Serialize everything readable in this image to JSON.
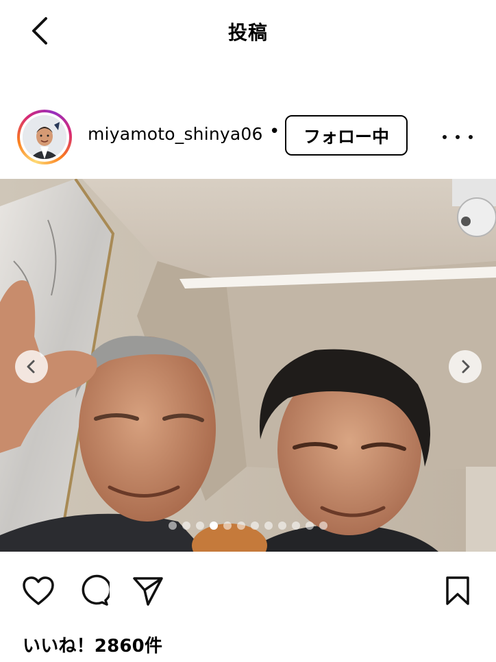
{
  "header": {
    "title": "投稿",
    "back_icon": "chevron-left-icon"
  },
  "post": {
    "username": "miyamoto_shinya06",
    "separator": "•",
    "follow_label": "フォロー中",
    "more_icon": "more-horizontal-icon",
    "avatar_ring_colors": [
      "#feda75",
      "#fa7e1e",
      "#d62976",
      "#962fbf"
    ]
  },
  "carousel": {
    "total": 12,
    "current": 4,
    "prev_icon": "chevron-left-icon",
    "next_icon": "chevron-right-icon"
  },
  "actions": {
    "like_icon": "heart-icon",
    "comment_icon": "comment-icon",
    "share_icon": "send-icon",
    "save_icon": "bookmark-icon"
  },
  "likes_text": "いいね！2860件"
}
